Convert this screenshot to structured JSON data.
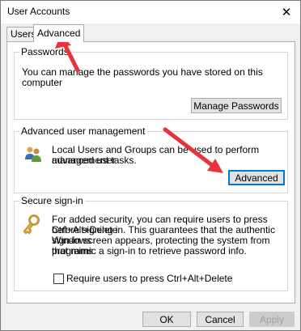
{
  "window": {
    "title": "User Accounts"
  },
  "tabs": [
    {
      "label": "Users",
      "active": false
    },
    {
      "label": "Advanced",
      "active": true
    }
  ],
  "passwords": {
    "title": "Passwords",
    "description": "You can manage the passwords you have stored on this computer",
    "button": "Manage Passwords"
  },
  "advanced_mgmt": {
    "title": "Advanced user management",
    "description_line1": "Local Users and Groups can be used to perform advanced user",
    "description_line2": "management tasks.",
    "button": "Advanced",
    "icon": "users-group-icon"
  },
  "secure_signin": {
    "title": "Secure sign-in",
    "lines": [
      "For added security, you can require users to press Ctrl+Alt+Delete",
      "before signing in. This guarantees that the authentic Windows",
      "sign-in screen appears, protecting the system from programs",
      "that mimic a sign-in to retrieve password info."
    ],
    "checkbox_label": "Require users to press Ctrl+Alt+Delete",
    "checkbox_checked": false,
    "icon": "key-icon"
  },
  "footer": {
    "ok": "OK",
    "cancel": "Cancel",
    "apply": "Apply"
  },
  "colors": {
    "annotation_arrow": "#e8323c",
    "focus": "#0078d7"
  }
}
